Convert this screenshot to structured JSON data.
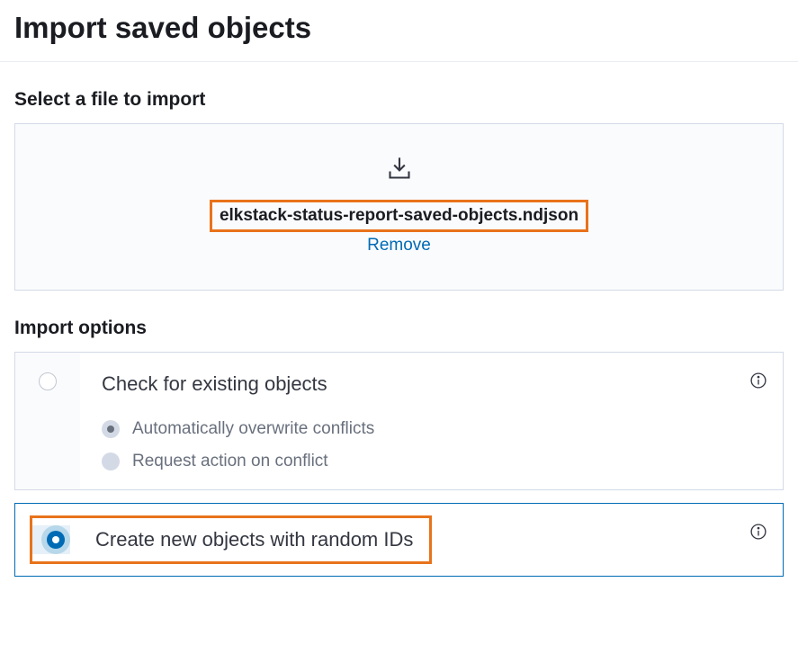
{
  "pageTitle": "Import saved objects",
  "sectionFile": {
    "title": "Select a file to import",
    "filename": "elkstack-status-report-saved-objects.ndjson",
    "removeLabel": "Remove"
  },
  "sectionOptions": {
    "title": "Import options",
    "option1": {
      "label": "Check for existing objects",
      "sub1": "Automatically overwrite conflicts",
      "sub2": "Request action on conflict"
    },
    "option2": {
      "label": "Create new objects with random IDs"
    }
  }
}
